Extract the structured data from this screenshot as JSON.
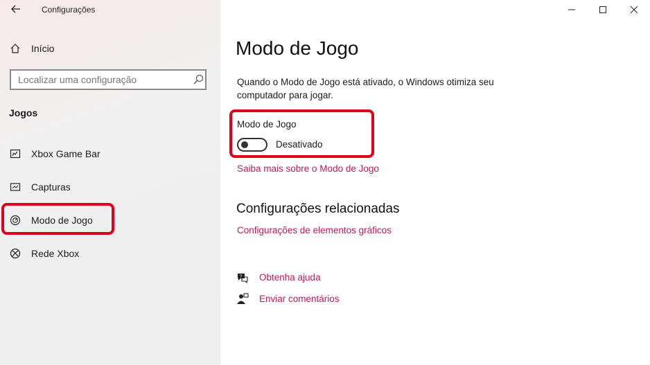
{
  "window": {
    "title": "Configurações",
    "controls": [
      "minimize",
      "maximize",
      "close"
    ]
  },
  "sidebar": {
    "home_label": "Início",
    "search_placeholder": "Localizar uma configuração",
    "section_title": "Jogos",
    "items": [
      {
        "label": "Xbox Game Bar",
        "icon": "xbox-game-bar-icon"
      },
      {
        "label": "Capturas",
        "icon": "captures-icon"
      },
      {
        "label": "Modo de Jogo",
        "icon": "game-mode-icon",
        "selected": true
      },
      {
        "label": "Rede Xbox",
        "icon": "xbox-icon"
      }
    ]
  },
  "main": {
    "title": "Modo de Jogo",
    "description": "Quando o Modo de Jogo está ativado, o Windows otimiza seu computador para jogar.",
    "setting_label": "Modo de Jogo",
    "toggle_state": "Desativado",
    "toggle_on": false,
    "learn_more_link": "Saiba mais sobre o Modo de Jogo",
    "related_title": "Configurações relacionadas",
    "related_link": "Configurações de elementos gráficos",
    "help_link": "Obtenha ajuda",
    "feedback_link": "Enviar comentários"
  },
  "colors": {
    "accent_link": "#c2185b",
    "highlight_box": "#e0001b"
  }
}
